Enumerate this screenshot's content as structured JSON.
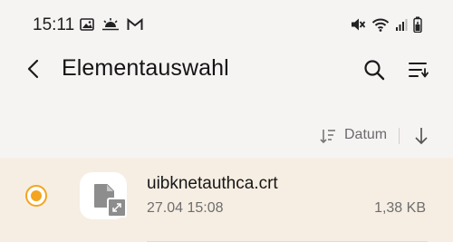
{
  "status_bar": {
    "time": "15:11",
    "left_icons": [
      "gallery-icon",
      "weather-icon",
      "gmail-icon"
    ],
    "right_icons": [
      "mute-icon",
      "wifi-icon",
      "signal-icon",
      "battery-icon"
    ]
  },
  "app_bar": {
    "title": "Elementauswahl",
    "back_icon": "back-arrow-icon",
    "search_icon": "search-icon",
    "menu_icon": "sort-menu-icon"
  },
  "sort_bar": {
    "label": "Datum",
    "direction": "descending"
  },
  "files": [
    {
      "name": "uibknetauthca.crt",
      "date": "27.04 15:08",
      "size": "1,38 KB",
      "selected": true
    }
  ],
  "colors": {
    "accent": "#f3a51f",
    "background": "#f6f3f3",
    "selected_row": "#f6eee3"
  }
}
